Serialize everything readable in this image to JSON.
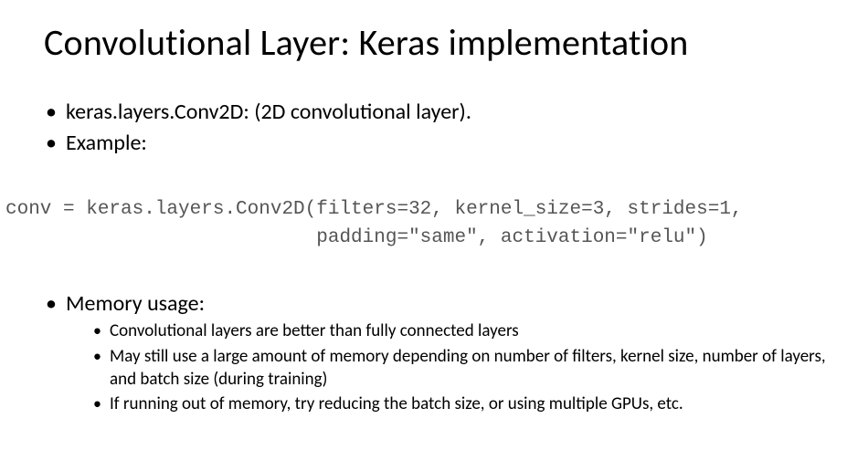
{
  "title": "Convolutional Layer: Keras implementation",
  "bullets": {
    "line1": "keras.layers.Conv2D: (2D convolutional layer).",
    "line2": "Example:",
    "line3": "Memory usage:"
  },
  "code": {
    "line1": "conv = keras.layers.Conv2D(filters=32, kernel_size=3, strides=1,",
    "line2": "                           padding=\"same\", activation=\"relu\")"
  },
  "sublist": {
    "m1": "Convolutional layers are better than fully connected layers",
    "m2": "May still use a large amount of memory depending on number of filters, kernel size, number of layers, and batch size (during training)",
    "m3": "If running out of memory, try reducing the batch size, or using multiple GPUs, etc."
  }
}
